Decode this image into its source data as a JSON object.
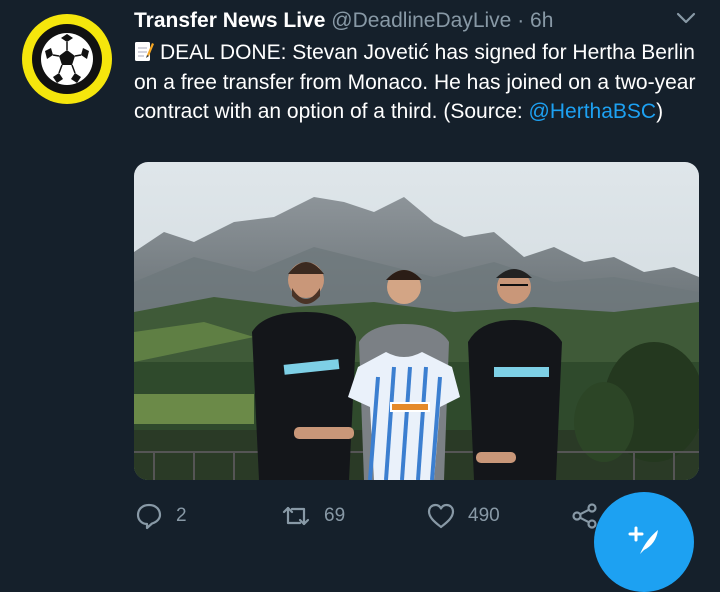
{
  "tweet": {
    "display_name": "Transfer News Live",
    "handle": "@DeadlineDayLive",
    "separator": "·",
    "time": "6h",
    "text_prefix": "DEAL DONE: Stevan Jovetić has signed for Hertha Berlin on a free transfer from Monaco. He has joined on a two-year contract with an option of a third. (Source: ",
    "mention": "@HerthaBSC",
    "text_suffix": ")",
    "emoji": "memo-icon"
  },
  "actions": {
    "replies": "2",
    "retweets": "69",
    "likes": "490"
  },
  "colors": {
    "background": "#15202b",
    "secondary_text": "#8899a6",
    "accent": "#1da1f2",
    "avatar_bg": "#f5e60c"
  }
}
